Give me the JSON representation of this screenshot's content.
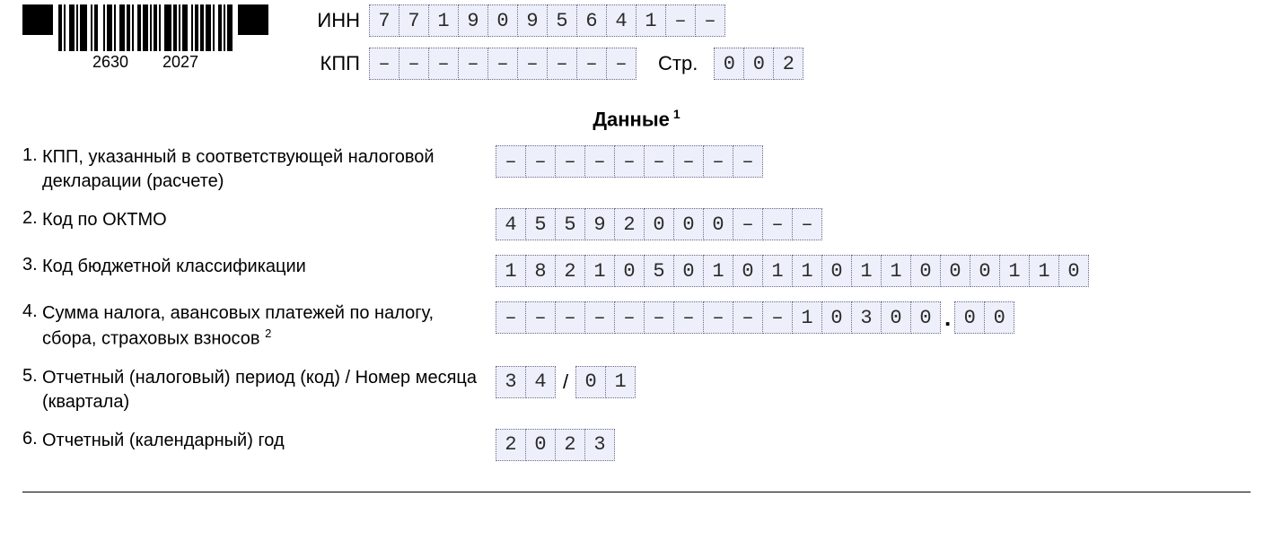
{
  "barcode": {
    "left": "2630",
    "right": "2027"
  },
  "header": {
    "inn_label": "ИНН",
    "inn": [
      "7",
      "7",
      "1",
      "9",
      "0",
      "9",
      "5",
      "6",
      "4",
      "1",
      "–",
      "–"
    ],
    "kpp_label": "КПП",
    "kpp": [
      "–",
      "–",
      "–",
      "–",
      "–",
      "–",
      "–",
      "–",
      "–"
    ],
    "page_label": "Стр.",
    "page": [
      "0",
      "0",
      "2"
    ]
  },
  "section_title": "Данные",
  "section_title_sup": "1",
  "rows": [
    {
      "n": "1.",
      "label": "КПП, указанный в соответствующей налоговой декларации (расчете)",
      "cells": [
        [
          "–",
          "–",
          "–",
          "–",
          "–",
          "–",
          "–",
          "–",
          "–"
        ]
      ]
    },
    {
      "n": "2.",
      "label": "Код по ОКТМО",
      "cells": [
        [
          "4",
          "5",
          "5",
          "9",
          "2",
          "0",
          "0",
          "0",
          "–",
          "–",
          "–"
        ]
      ]
    },
    {
      "n": "3.",
      "label": "Код бюджетной классификации",
      "cells": [
        [
          "1",
          "8",
          "2",
          "1",
          "0",
          "5",
          "0",
          "1",
          "0",
          "1",
          "1",
          "0",
          "1",
          "1",
          "0",
          "0",
          "0",
          "1",
          "1",
          "0"
        ]
      ]
    },
    {
      "n": "4.",
      "label": "Сумма налога, авансовых платежей по налогу, сбора, страховых взносов",
      "label_sup": "2",
      "int": [
        "–",
        "–",
        "–",
        "–",
        "–",
        "–",
        "–",
        "–",
        "–",
        "–",
        "1",
        "0",
        "3",
        "0",
        "0"
      ],
      "frac": [
        "0",
        "0"
      ]
    },
    {
      "n": "5.",
      "label": "Отчетный (налоговый) период (код) / Номер месяца (квартала)",
      "left": [
        "3",
        "4"
      ],
      "right": [
        "0",
        "1"
      ]
    },
    {
      "n": "6.",
      "label": "Отчетный (календарный) год",
      "cells": [
        [
          "2",
          "0",
          "2",
          "3"
        ]
      ]
    }
  ]
}
